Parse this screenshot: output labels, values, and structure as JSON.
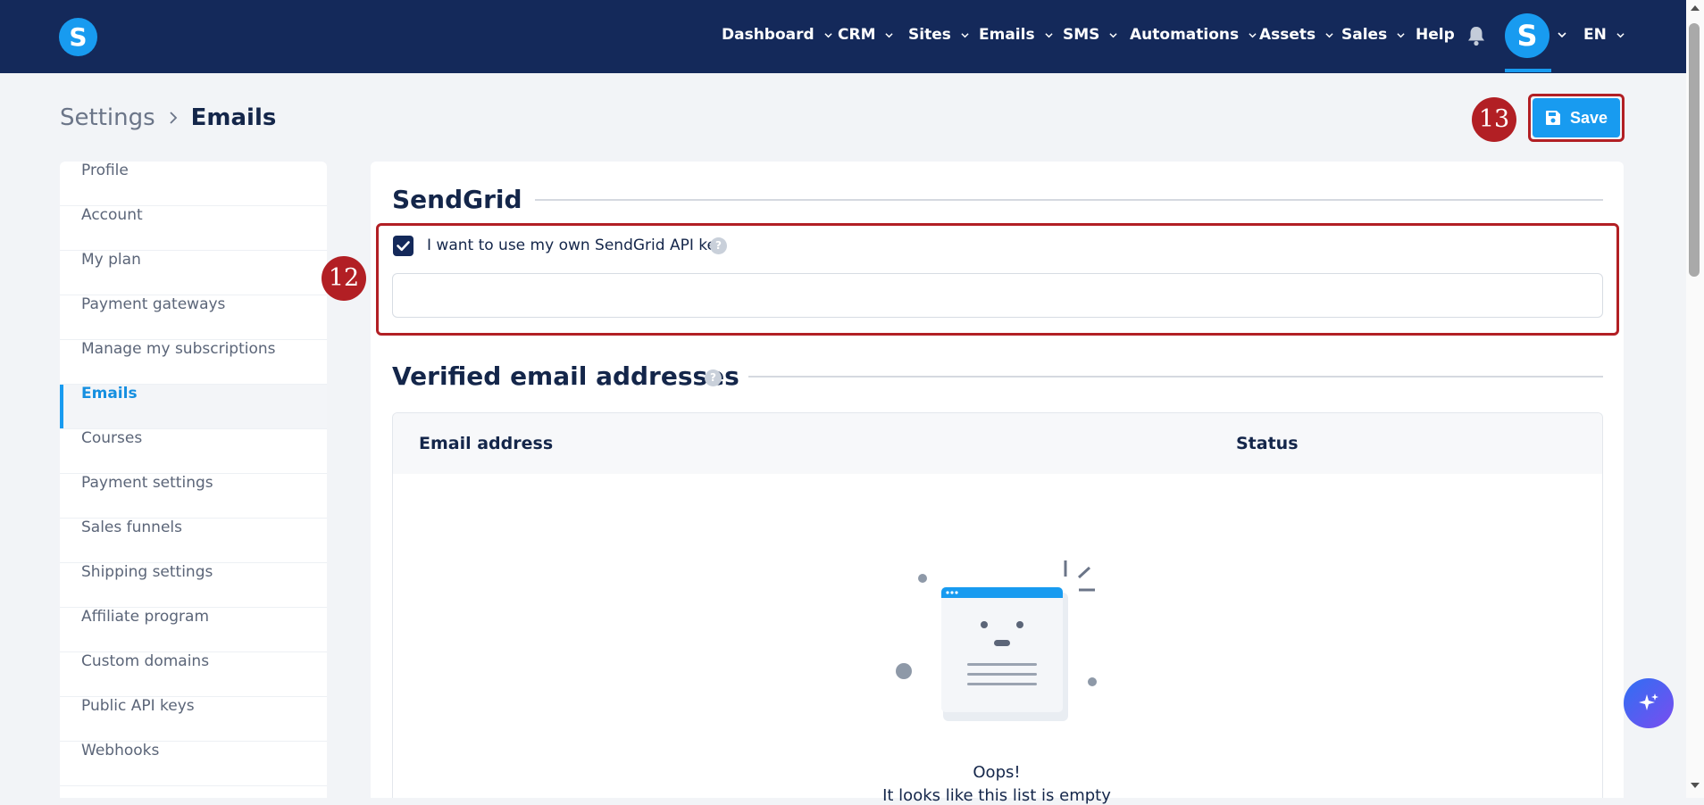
{
  "app": {
    "logo_letter": "S"
  },
  "topnav": {
    "items": [
      {
        "label": "Dashboard"
      },
      {
        "label": "CRM"
      },
      {
        "label": "Sites"
      },
      {
        "label": "Emails"
      },
      {
        "label": "SMS"
      },
      {
        "label": "Automations"
      },
      {
        "label": "Assets"
      },
      {
        "label": "Sales"
      },
      {
        "label": "Help"
      }
    ],
    "avatar_letter": "S",
    "language": "EN"
  },
  "header": {
    "breadcrumb_parent": "Settings",
    "breadcrumb_current": "Emails",
    "save_label": "Save"
  },
  "markers": {
    "sendgrid": "12",
    "save": "13"
  },
  "sidebar": {
    "items": [
      {
        "label": "Profile"
      },
      {
        "label": "Account"
      },
      {
        "label": "My plan"
      },
      {
        "label": "Payment gateways"
      },
      {
        "label": "Manage my subscriptions"
      },
      {
        "label": "Emails",
        "active": true
      },
      {
        "label": "Courses"
      },
      {
        "label": "Payment settings"
      },
      {
        "label": "Sales funnels"
      },
      {
        "label": "Shipping settings"
      },
      {
        "label": "Affiliate program"
      },
      {
        "label": "Custom domains"
      },
      {
        "label": "Public API keys"
      },
      {
        "label": "Webhooks"
      }
    ]
  },
  "sendgrid": {
    "title": "SendGrid",
    "checkbox_label": "I want to use my own SendGrid API key",
    "checkbox_checked": true,
    "api_key_value": "",
    "help_glyph": "?"
  },
  "verified": {
    "title": "Verified email addresses",
    "help_glyph": "?",
    "columns": [
      "Email address",
      "Status"
    ],
    "empty_title": "Oops!",
    "empty_subtitle": "It looks like this list is empty"
  },
  "colors": {
    "navbar": "#14295a",
    "accent": "#189bf0",
    "annotation": "#b21f24"
  },
  "icons": [
    "chevron-down-icon",
    "bell-icon",
    "save-icon",
    "check-icon",
    "help-icon",
    "sparkle-icon"
  ]
}
